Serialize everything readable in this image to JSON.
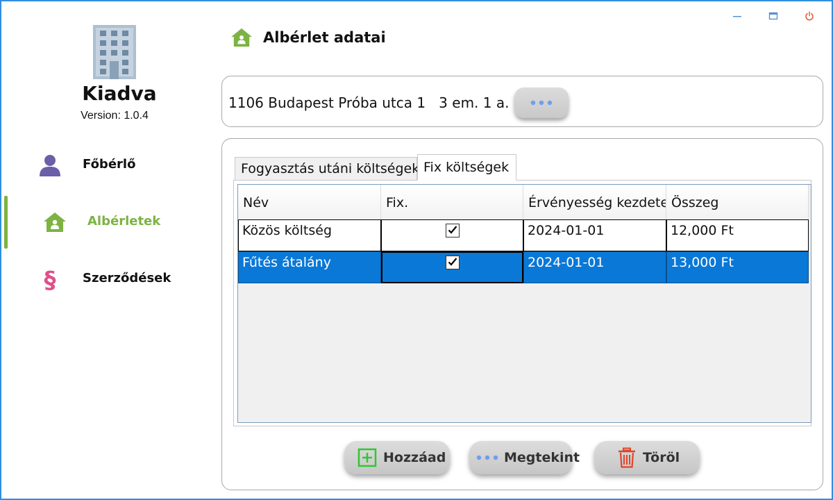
{
  "window": {
    "controls": [
      "minimize-icon",
      "maximize-icon",
      "power-icon"
    ],
    "accent_border": "#2f8fe0"
  },
  "sidebar": {
    "app_name": "Kiadva",
    "version": "Version: 1.0.4",
    "items": [
      {
        "label": "Főbérlő",
        "icon": "person-icon",
        "color": "#6a5fa8",
        "active": false
      },
      {
        "label": "Albérletek",
        "icon": "house-icon",
        "color": "#7cb342",
        "active": true
      },
      {
        "label": "Szerződések",
        "icon": "section-sign-icon",
        "color": "#e0508a",
        "active": false
      }
    ]
  },
  "header": {
    "title": "Albérlet adatai",
    "icon": "house-icon"
  },
  "address": {
    "text": "1106 Budapest Próba utca 1   3 em. 1 a.",
    "button_icon": "more-dots-icon"
  },
  "tabs": [
    {
      "label": "Fogyasztás utáni költségek",
      "active": false
    },
    {
      "label": "Fix költségek",
      "active": true
    }
  ],
  "grid": {
    "columns": [
      "Név",
      "Fix.",
      "Érvényesség kezdete",
      "Összeg"
    ],
    "rows": [
      {
        "name": "Közös költség",
        "fix": true,
        "start": "2024-01-01",
        "amount": "12,000 Ft",
        "selected": false
      },
      {
        "name": "Fűtés átalány",
        "fix": true,
        "start": "2024-01-01",
        "amount": "13,000 Ft",
        "selected": true
      }
    ],
    "selection_color": "#0a78d7"
  },
  "actions": {
    "add_label": "Hozzáad",
    "view_label": "Megtekint",
    "delete_label": "Töröl"
  }
}
